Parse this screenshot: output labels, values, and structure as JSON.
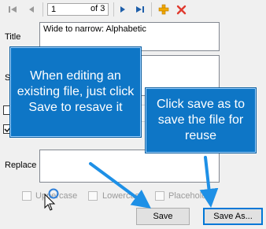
{
  "toolbar": {
    "first_icon": "first-record-icon",
    "prev_icon": "previous-record-icon",
    "record_value": "1",
    "record_count": "of 3",
    "next_icon": "next-record-icon",
    "last_icon": "last-record-icon",
    "add_icon": "add-icon",
    "delete_icon": "delete-icon"
  },
  "form": {
    "title_label": "Title",
    "title_value": "Wide to narrow: Alphabetic",
    "sort_label": "So",
    "replace_label": "Replace",
    "options": {
      "uppercase": "Uppercase",
      "lowercase": "Lowercase",
      "placeholder": "Placehold"
    },
    "save_label": "Save",
    "save_as_label": "Save As..."
  },
  "callouts": {
    "left": "When editing an existing file, just click Save to resave it",
    "right": "Click save as to save the file for reuse"
  },
  "colors": {
    "callout_bg": "#0e76c6",
    "arrow": "#1e90e6",
    "delete": "#e03a2f",
    "add": "#f2a900",
    "nav": "#1f5faa",
    "focus": "#0078d7"
  }
}
